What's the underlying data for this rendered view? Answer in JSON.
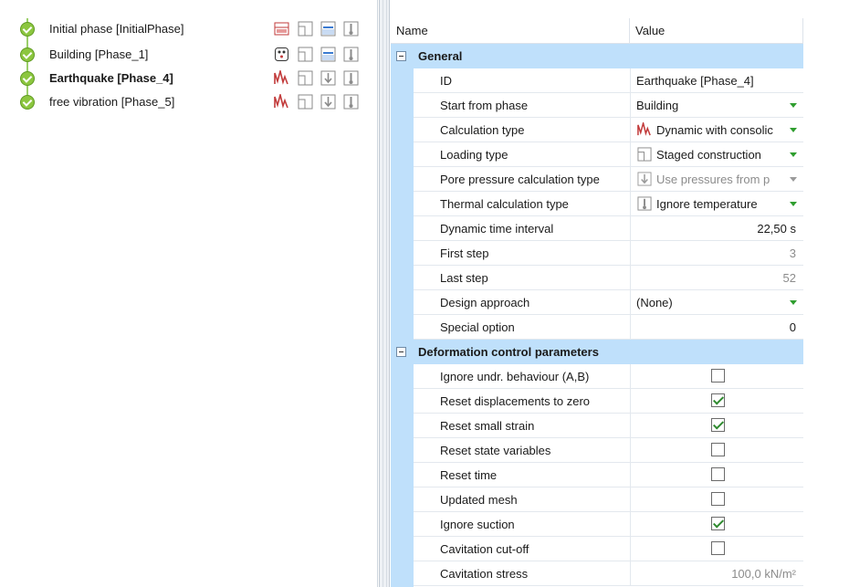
{
  "phases": [
    {
      "label": "Initial phase [InitialPhase]",
      "bold": false,
      "calc_icon": "k0-procedure-icon",
      "load_icon": "staged-construction-icon",
      "pore_icon": "phreatic-pore-pressure-icon",
      "thermal_icon": "ignore-temperature-icon"
    },
    {
      "label": "Building [Phase_1]",
      "bold": false,
      "calc_icon": "plastic-calculation-icon",
      "load_icon": "staged-construction-icon",
      "pore_icon": "phreatic-pore-pressure-icon",
      "thermal_icon": "ignore-temperature-icon"
    },
    {
      "label": "Earthquake [Phase_4]",
      "bold": true,
      "calc_icon": "dynamic-consolidation-icon",
      "load_icon": "staged-construction-icon",
      "pore_icon": "use-previous-pressures-icon",
      "thermal_icon": "ignore-temperature-icon"
    },
    {
      "label": "free vibration [Phase_5]",
      "bold": false,
      "calc_icon": "dynamic-consolidation-icon",
      "load_icon": "staged-construction-icon",
      "pore_icon": "use-previous-pressures-icon",
      "thermal_icon": "ignore-temperature-icon"
    }
  ],
  "grid": {
    "col_name": "Name",
    "col_value": "Value",
    "general": {
      "title": "General",
      "rows": [
        {
          "name": "ID",
          "value": "Earthquake [Phase_4]"
        },
        {
          "name": "Start from phase",
          "value": "Building"
        },
        {
          "name": "Calculation type",
          "value": "Dynamic with consolic"
        },
        {
          "name": "Loading type",
          "value": "Staged construction"
        },
        {
          "name": "Pore pressure calculation type",
          "value": "Use pressures from p"
        },
        {
          "name": "Thermal calculation type",
          "value": "Ignore temperature"
        },
        {
          "name": "Dynamic time interval",
          "value": "22,50 s"
        },
        {
          "name": "First step",
          "value": "3"
        },
        {
          "name": "Last step",
          "value": "52"
        },
        {
          "name": "Design approach",
          "value": "(None)"
        },
        {
          "name": "Special option",
          "value": "0"
        }
      ]
    },
    "deformation": {
      "title": "Deformation control parameters",
      "rows": [
        {
          "name": "Ignore undr. behaviour (A,B)",
          "checked": false
        },
        {
          "name": "Reset displacements to zero",
          "checked": true
        },
        {
          "name": "Reset small strain",
          "checked": true
        },
        {
          "name": "Reset state variables",
          "checked": false
        },
        {
          "name": "Reset time",
          "checked": false
        },
        {
          "name": "Updated mesh",
          "checked": false
        },
        {
          "name": "Ignore suction",
          "checked": true
        },
        {
          "name": "Cavitation cut-off",
          "checked": false
        },
        {
          "name": "Cavitation stress",
          "value": "100,0 kN/m²"
        }
      ]
    }
  },
  "colors": {
    "accent": "#bfe0fb",
    "dropdown_arrow": "#2f9e2f",
    "check": "#2f8a2f",
    "phase_ok": "#8cc63f"
  }
}
